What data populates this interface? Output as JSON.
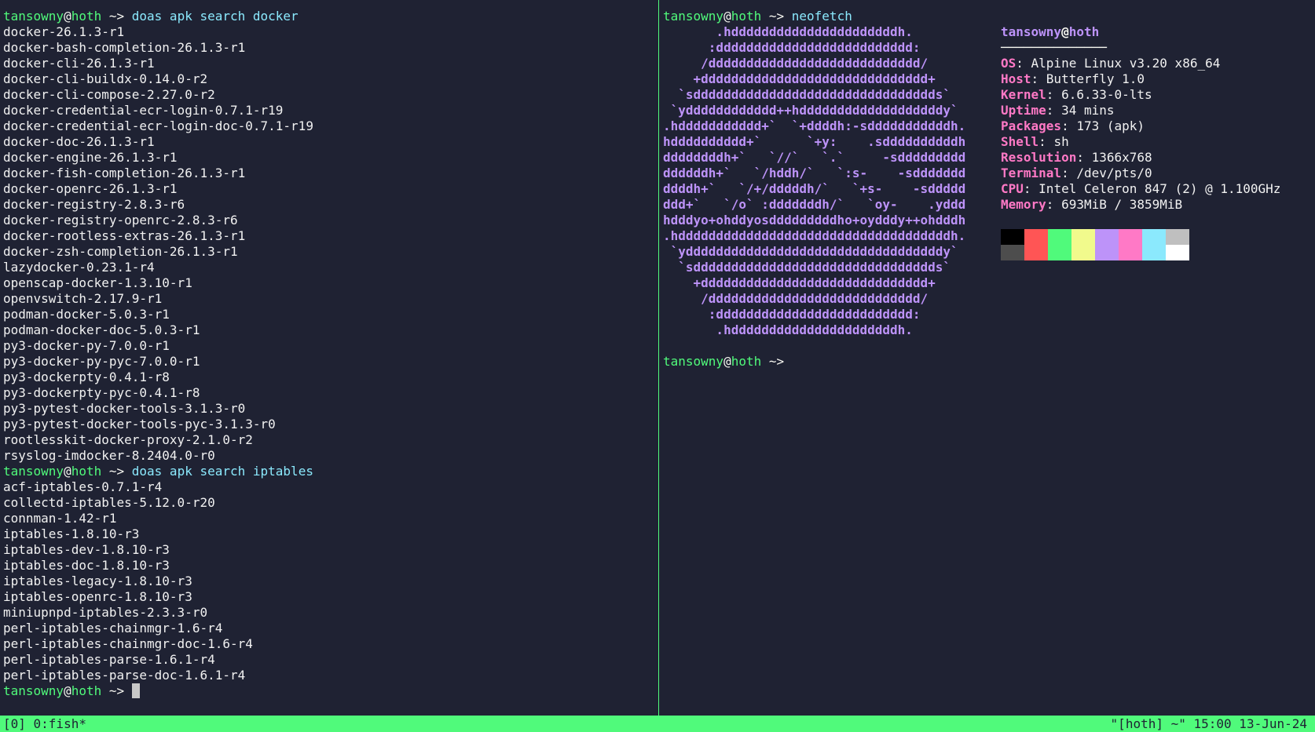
{
  "left": {
    "prompt": {
      "user": "tansowny",
      "at": "@",
      "host": "hoth",
      "path": " ~> "
    },
    "cmd1": "doas apk search docker",
    "docker_results": [
      "docker-26.1.3-r1",
      "docker-bash-completion-26.1.3-r1",
      "docker-cli-26.1.3-r1",
      "docker-cli-buildx-0.14.0-r2",
      "docker-cli-compose-2.27.0-r2",
      "docker-credential-ecr-login-0.7.1-r19",
      "docker-credential-ecr-login-doc-0.7.1-r19",
      "docker-doc-26.1.3-r1",
      "docker-engine-26.1.3-r1",
      "docker-fish-completion-26.1.3-r1",
      "docker-openrc-26.1.3-r1",
      "docker-registry-2.8.3-r6",
      "docker-registry-openrc-2.8.3-r6",
      "docker-rootless-extras-26.1.3-r1",
      "docker-zsh-completion-26.1.3-r1",
      "lazydocker-0.23.1-r4",
      "openscap-docker-1.3.10-r1",
      "openvswitch-2.17.9-r1",
      "podman-docker-5.0.3-r1",
      "podman-docker-doc-5.0.3-r1",
      "py3-docker-py-7.0.0-r1",
      "py3-docker-py-pyc-7.0.0-r1",
      "py3-dockerpty-0.4.1-r8",
      "py3-dockerpty-pyc-0.4.1-r8",
      "py3-pytest-docker-tools-3.1.3-r0",
      "py3-pytest-docker-tools-pyc-3.1.3-r0",
      "rootlesskit-docker-proxy-2.1.0-r2",
      "rsyslog-imdocker-8.2404.0-r0"
    ],
    "cmd2": "doas apk search iptables",
    "iptables_results": [
      "acf-iptables-0.7.1-r4",
      "collectd-iptables-5.12.0-r20",
      "connman-1.42-r1",
      "iptables-1.8.10-r3",
      "iptables-dev-1.8.10-r3",
      "iptables-doc-1.8.10-r3",
      "iptables-legacy-1.8.10-r3",
      "iptables-openrc-1.8.10-r3",
      "miniupnpd-iptables-2.3.3-r0",
      "perl-iptables-chainmgr-1.6-r4",
      "perl-iptables-chainmgr-doc-1.6-r4",
      "perl-iptables-parse-1.6.1-r4",
      "perl-iptables-parse-doc-1.6.1-r4"
    ]
  },
  "right": {
    "cmd": "neofetch",
    "logo": [
      "       .hddddddddddddddddddddddh.",
      "      :dddddddddddddddddddddddddd:",
      "     /dddddddddddddddddddddddddddd/",
      "    +dddddddddddddddddddddddddddddd+",
      "  `sdddddddddddddddddddddddddddddddds`",
      " `ydddddddddddd++hdddddddddddddddddddy`",
      ".hddddddddddd+`  `+ddddh:-sdddddddddddh.",
      "hdddddddddd+`      `+y:    .sddddddddddh",
      "ddddddddh+`   `//`   `.`     -sddddddddd",
      "ddddddh+`   `/hddh/`   `:s-    -sddddddd",
      "ddddh+`   `/+/dddddh/`   `+s-    -sddddd",
      "ddd+`   `/o` :dddddddh/`   `oy-    .yddd",
      "hdddyo+ohddyosdddddddddho+oydddy++ohdddh",
      ".hddddddddddddddddddddddddddddddddddddh.",
      " `yddddddddddddddddddddddddddddddddddy`",
      "  `sdddddddddddddddddddddddddddddddds`",
      "    +dddddddddddddddddddddddddddddd+",
      "     /dddddddddddddddddddddddddddd/",
      "      :dddddddddddddddddddddddddd:",
      "       .hddddddddddddddddddddddh."
    ],
    "info_title": {
      "user": "tansowny",
      "at": "@",
      "host": "hoth"
    },
    "separator": "──────────────",
    "info": [
      {
        "key": "OS",
        "value": "Alpine Linux v3.20 x86_64"
      },
      {
        "key": "Host",
        "value": "Butterfly 1.0"
      },
      {
        "key": "Kernel",
        "value": "6.6.33-0-lts"
      },
      {
        "key": "Uptime",
        "value": "34 mins"
      },
      {
        "key": "Packages",
        "value": "173 (apk)"
      },
      {
        "key": "Shell",
        "value": "sh"
      },
      {
        "key": "Resolution",
        "value": "1366x768"
      },
      {
        "key": "Terminal",
        "value": "/dev/pts/0"
      },
      {
        "key": "CPU",
        "value": "Intel Celeron 847 (2) @ 1.100GHz"
      },
      {
        "key": "Memory",
        "value": "693MiB / 3859MiB"
      }
    ],
    "palette_top": [
      "#000000",
      "#ff5555",
      "#50fa7b",
      "#f1fa8c",
      "#bd93f9",
      "#ff79c6",
      "#8be9fd",
      "#bfbfbf"
    ],
    "palette_bottom": [
      "#4d4d4d",
      "#ff5555",
      "#50fa7b",
      "#f1fa8c",
      "#bd93f9",
      "#ff79c6",
      "#8be9fd",
      "#ffffff"
    ]
  },
  "status": {
    "left": "[0] 0:fish*",
    "right": "\"[hoth] ~\" 15:00 13-Jun-24"
  }
}
